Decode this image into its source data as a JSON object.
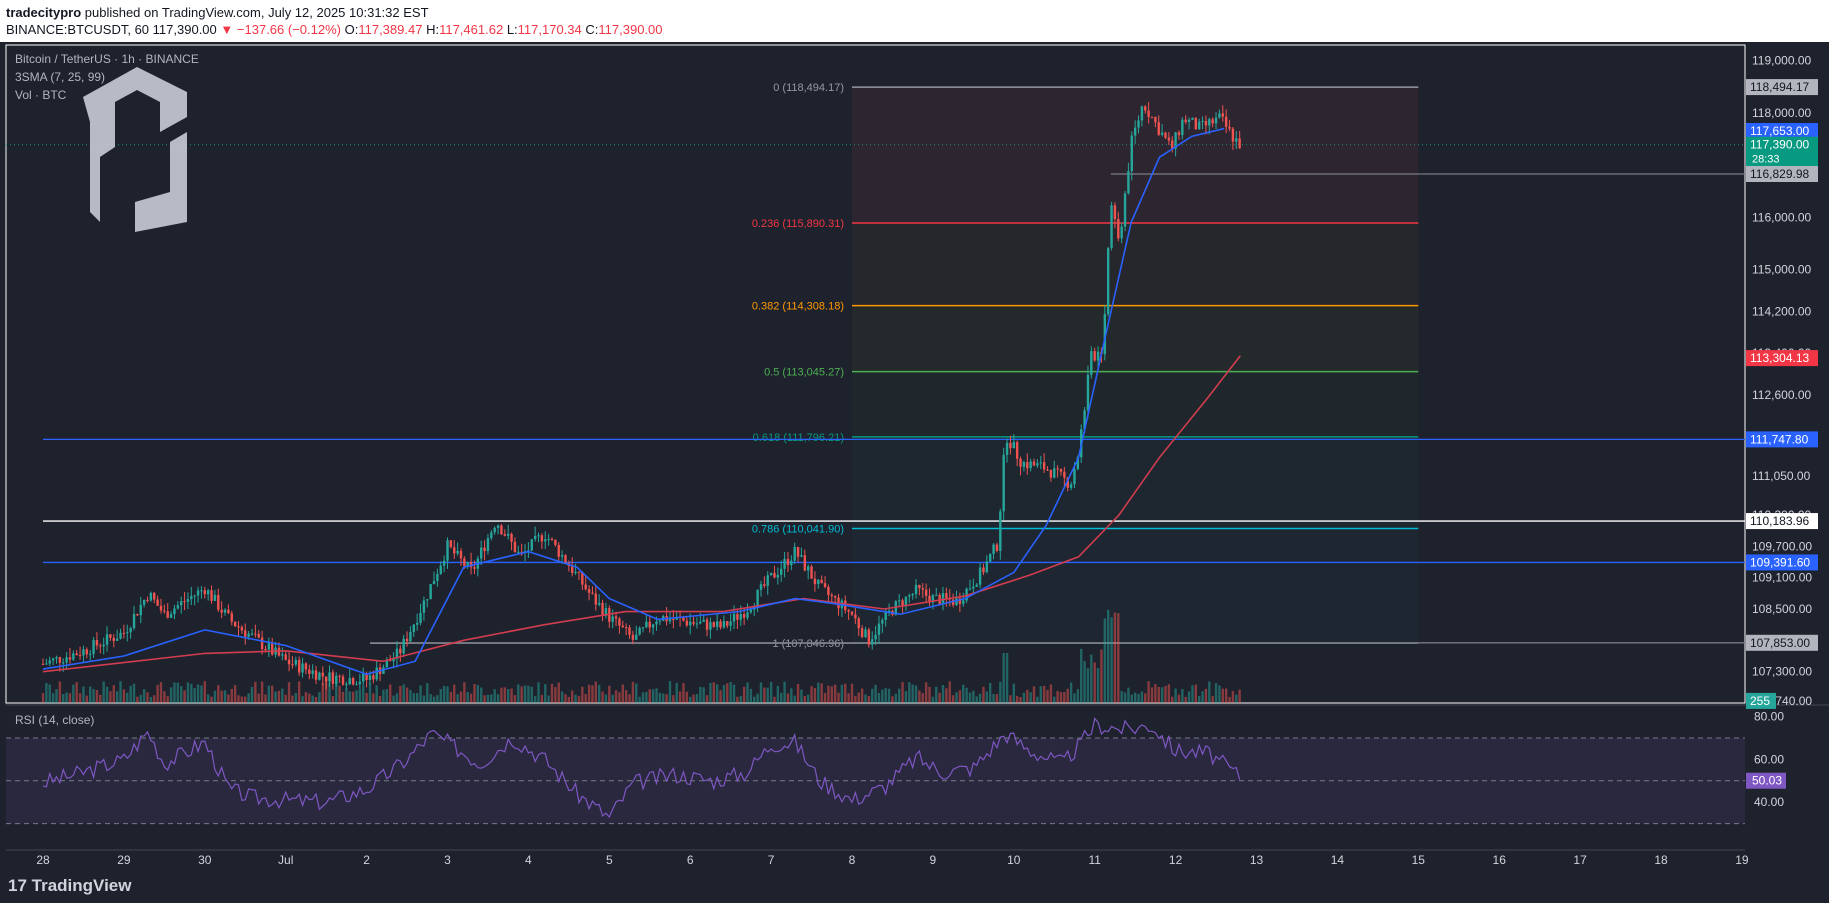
{
  "header": {
    "publisher": "tradecitypro",
    "published_text": " published on TradingView.com, July 12, 2025 10:31:32 EST",
    "symbol_line": "BINANCE:BTCUSDT, 60",
    "last": "117,390.00",
    "change": "−137.66 (−0.12%)",
    "o_label": "O:",
    "o": "117,389.47",
    "h_label": "H:",
    "h": "117,461.62",
    "l_label": "L:",
    "l": "117,170.34",
    "c_label": "C:",
    "c": "117,390.00"
  },
  "legend": {
    "instrument": "Bitcoin / TetherUS · 1h · BINANCE",
    "sma": "3SMA (7, 25, 99)",
    "vol": "Vol · BTC"
  },
  "rsi_title": "RSI (14, close)",
  "footer": {
    "brand": "TradingView"
  },
  "colors": {
    "bg": "#1e222d",
    "grid": "#2a2e39",
    "up": "#26a69a",
    "down": "#ef5350",
    "sma_blue": "#2962ff",
    "sma_red": "#d13d4f",
    "rsi": "#7e57c2",
    "fib_0236": "#f23645",
    "fib_0382": "#ff9800",
    "fib_05": "#4caf50",
    "fib_0618": "#089981",
    "fib_0786": "#00bcd4",
    "level_blue": "#2962ff"
  },
  "chart_data": {
    "type": "candlestick",
    "y_range": [
      106700,
      119300
    ],
    "price_ticks": [
      "119,000.00",
      "118,000.00",
      "116,000.00",
      "115,000.00",
      "114,200.00",
      "113,400.00",
      "112,600.00",
      "111,050.00",
      "110,300.00",
      "109,700.00",
      "109,100.00",
      "108,500.00",
      "107,300.00",
      "106,740.00"
    ],
    "price_tick_values": [
      119000,
      118000,
      116000,
      115000,
      114200,
      113400,
      112600,
      111050,
      110300,
      109700,
      109100,
      108500,
      107300,
      106740
    ],
    "x_ticks": [
      {
        "label": "28",
        "day": 0
      },
      {
        "label": "29",
        "day": 1
      },
      {
        "label": "30",
        "day": 2
      },
      {
        "label": "Jul",
        "day": 3
      },
      {
        "label": "2",
        "day": 4
      },
      {
        "label": "3",
        "day": 5
      },
      {
        "label": "4",
        "day": 6
      },
      {
        "label": "5",
        "day": 7
      },
      {
        "label": "6",
        "day": 8
      },
      {
        "label": "7",
        "day": 9
      },
      {
        "label": "8",
        "day": 10
      },
      {
        "label": "9",
        "day": 11
      },
      {
        "label": "10",
        "day": 12
      },
      {
        "label": "11",
        "day": 13
      },
      {
        "label": "12",
        "day": 14
      },
      {
        "label": "13",
        "day": 15
      },
      {
        "label": "14",
        "day": 16
      },
      {
        "label": "15",
        "day": 17
      },
      {
        "label": "16",
        "day": 18
      },
      {
        "label": "17",
        "day": 19
      },
      {
        "label": "18",
        "day": 20
      },
      {
        "label": "19",
        "day": 21
      }
    ],
    "price_path": [
      [
        0,
        107450
      ],
      [
        0.5,
        107700
      ],
      [
        1,
        108050
      ],
      [
        1.3,
        108800
      ],
      [
        1.5,
        108400
      ],
      [
        2,
        108900
      ],
      [
        2.3,
        108300
      ],
      [
        2.6,
        107950
      ],
      [
        3,
        107500
      ],
      [
        3.5,
        107200
      ],
      [
        4,
        107150
      ],
      [
        4.4,
        107650
      ],
      [
        4.7,
        108600
      ],
      [
        5,
        109700
      ],
      [
        5.3,
        109200
      ],
      [
        5.6,
        110200
      ],
      [
        5.9,
        109500
      ],
      [
        6.2,
        109950
      ],
      [
        6.5,
        109350
      ],
      [
        6.8,
        108700
      ],
      [
        7,
        108350
      ],
      [
        7.3,
        107900
      ],
      [
        7.6,
        108350
      ],
      [
        8,
        108250
      ],
      [
        8.4,
        108150
      ],
      [
        8.7,
        108500
      ],
      [
        9,
        109100
      ],
      [
        9.3,
        109600
      ],
      [
        9.6,
        108900
      ],
      [
        10,
        108400
      ],
      [
        10.2,
        107900
      ],
      [
        10.5,
        108500
      ],
      [
        10.8,
        108850
      ],
      [
        11,
        108700
      ],
      [
        11.3,
        108650
      ],
      [
        11.6,
        109200
      ],
      [
        11.8,
        109750
      ],
      [
        11.9,
        111850
      ],
      [
        12.1,
        111300
      ],
      [
        12.4,
        111200
      ],
      [
        12.7,
        110900
      ],
      [
        12.8,
        111500
      ],
      [
        12.95,
        113300
      ],
      [
        13.1,
        113500
      ],
      [
        13.2,
        116400
      ],
      [
        13.3,
        115500
      ],
      [
        13.45,
        117400
      ],
      [
        13.6,
        118200
      ],
      [
        13.75,
        117800
      ],
      [
        13.95,
        117300
      ],
      [
        14.1,
        117900
      ],
      [
        14.3,
        117700
      ],
      [
        14.55,
        117900
      ],
      [
        14.7,
        117550
      ],
      [
        14.8,
        117390
      ]
    ],
    "sma_blue": [
      [
        0,
        107350
      ],
      [
        1,
        107600
      ],
      [
        2,
        108100
      ],
      [
        3,
        107800
      ],
      [
        4,
        107250
      ],
      [
        4.6,
        107500
      ],
      [
        5.2,
        109300
      ],
      [
        6,
        109600
      ],
      [
        6.6,
        109300
      ],
      [
        7,
        108700
      ],
      [
        7.6,
        108300
      ],
      [
        8.6,
        108450
      ],
      [
        9.3,
        108700
      ],
      [
        9.8,
        108600
      ],
      [
        10.6,
        108400
      ],
      [
        11.4,
        108700
      ],
      [
        12,
        109200
      ],
      [
        12.4,
        110100
      ],
      [
        12.8,
        111400
      ],
      [
        13.1,
        113500
      ],
      [
        13.45,
        115900
      ],
      [
        13.8,
        117150
      ],
      [
        14.2,
        117550
      ],
      [
        14.6,
        117700
      ]
    ],
    "sma_red": [
      [
        0,
        107300
      ],
      [
        2,
        107650
      ],
      [
        3,
        107700
      ],
      [
        4.2,
        107500
      ],
      [
        5.2,
        107900
      ],
      [
        6.2,
        108200
      ],
      [
        7.2,
        108450
      ],
      [
        8.4,
        108450
      ],
      [
        9.4,
        108700
      ],
      [
        10.4,
        108500
      ],
      [
        11.4,
        108750
      ],
      [
        12.2,
        109150
      ],
      [
        12.8,
        109500
      ],
      [
        13.3,
        110300
      ],
      [
        13.8,
        111400
      ],
      [
        14.4,
        112550
      ],
      [
        14.8,
        113350
      ]
    ],
    "rsi_path": [
      [
        0,
        49
      ],
      [
        0.5,
        54
      ],
      [
        1,
        60
      ],
      [
        1.3,
        73
      ],
      [
        1.5,
        58
      ],
      [
        2,
        68
      ],
      [
        2.3,
        46
      ],
      [
        2.6,
        42
      ],
      [
        3,
        41
      ],
      [
        3.5,
        40
      ],
      [
        4,
        46
      ],
      [
        4.5,
        60
      ],
      [
        4.8,
        72
      ],
      [
        5,
        68
      ],
      [
        5.4,
        58
      ],
      [
        5.8,
        70
      ],
      [
        6.2,
        60
      ],
      [
        6.6,
        44
      ],
      [
        7,
        33
      ],
      [
        7.3,
        49
      ],
      [
        7.8,
        53
      ],
      [
        8.3,
        50
      ],
      [
        8.7,
        54
      ],
      [
        9,
        67
      ],
      [
        9.3,
        68
      ],
      [
        9.6,
        50
      ],
      [
        10,
        41
      ],
      [
        10.4,
        47
      ],
      [
        10.8,
        61
      ],
      [
        11.1,
        54
      ],
      [
        11.5,
        56
      ],
      [
        11.9,
        72
      ],
      [
        12.2,
        64
      ],
      [
        12.6,
        58
      ],
      [
        12.8,
        66
      ],
      [
        13,
        76
      ],
      [
        13.4,
        74
      ],
      [
        13.7,
        76
      ],
      [
        14,
        64
      ],
      [
        14.4,
        63
      ],
      [
        14.8,
        52
      ]
    ],
    "rsi_ticks": [
      "80.00",
      "60.00",
      "40.00"
    ],
    "rsi_tick_values": [
      80,
      60,
      40
    ],
    "rsi_bands": [
      70,
      50,
      30
    ],
    "rsi_range": [
      27,
      84
    ],
    "fib": {
      "start_day": 10.0,
      "end_day": 17.0,
      "levels": [
        {
          "ratio": "0",
          "price": 118494.17,
          "text": "0 (118,494.17)"
        },
        {
          "ratio": "0.236",
          "price": 115890.31,
          "text": "0.236 (115,890.31)"
        },
        {
          "ratio": "0.382",
          "price": 114308.18,
          "text": "0.382 (114,308.18)"
        },
        {
          "ratio": "0.5",
          "price": 113045.27,
          "text": "0.5 (113,045.27)"
        },
        {
          "ratio": "0.618",
          "price": 111796.21,
          "text": "0.618 (111,796.21)"
        },
        {
          "ratio": "0.786",
          "price": 110041.9,
          "text": "0.786 (110,041.90)"
        },
        {
          "ratio": "1",
          "price": 107846.96,
          "text": "1 (107,846.96)"
        }
      ]
    },
    "horizontal_levels": [
      {
        "price": 111747.8,
        "color": "#2962ff",
        "from_day": 0
      },
      {
        "price": 110183.96,
        "color": "#ffffff",
        "from_day": 0
      },
      {
        "price": 109391.6,
        "color": "#2962ff",
        "from_day": 0
      },
      {
        "price": 116829.98,
        "color": "#787b86",
        "from_day": 13.2
      },
      {
        "price": 107853.0,
        "color": "#787b86",
        "from_day": 4.5
      }
    ],
    "price_badges": [
      {
        "text": "118,494.17",
        "price": 118494.17,
        "bg": "#b2b5be",
        "fg": "#131722"
      },
      {
        "text": "117,653.00",
        "price": 117653.0,
        "bg": "#2962ff",
        "fg": "#ffffff"
      },
      {
        "text": "117,390.00",
        "price": 117390.0,
        "bg": "#089981",
        "fg": "#ffffff",
        "sub": "28:33"
      },
      {
        "text": "116,829.98",
        "price": 116829.98,
        "bg": "#b2b5be",
        "fg": "#131722"
      },
      {
        "text": "113,304.13",
        "price": 113304.13,
        "bg": "#f23645",
        "fg": "#ffffff"
      },
      {
        "text": "111,747.80",
        "price": 111747.8,
        "bg": "#2962ff",
        "fg": "#ffffff"
      },
      {
        "text": "110,183.96",
        "price": 110183.96,
        "bg": "#ffffff",
        "fg": "#131722"
      },
      {
        "text": "109,391.60",
        "price": 109391.6,
        "bg": "#2962ff",
        "fg": "#ffffff"
      },
      {
        "text": "107,853.00",
        "price": 107853.0,
        "bg": "#b2b5be",
        "fg": "#131722"
      },
      {
        "text": "255",
        "price": 106740,
        "bg": "#26a69a",
        "fg": "#ffffff"
      }
    ],
    "rsi_badge": {
      "text": "50.03",
      "value": 50.03,
      "bg": "#7e57c2",
      "fg": "#ffffff"
    }
  }
}
